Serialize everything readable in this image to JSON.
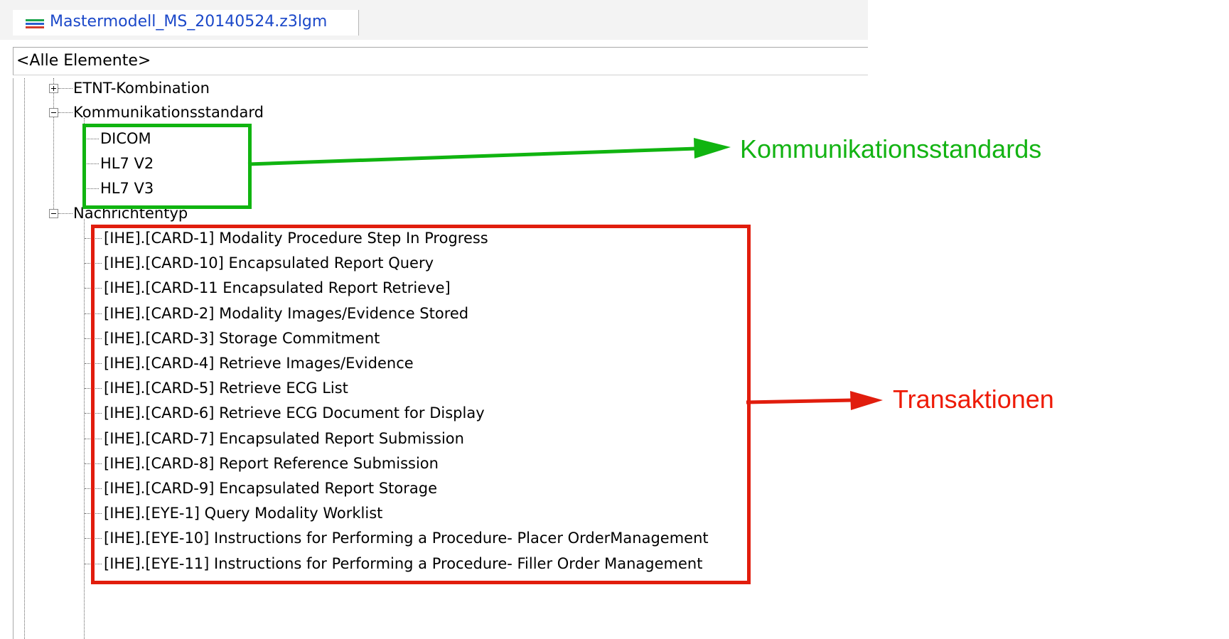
{
  "tab": {
    "title": "Mastermodell_MS_20140524.z3lgm",
    "icon": "list-icon"
  },
  "filter": {
    "value": "<Alle Elemente>"
  },
  "tree": {
    "groups": [
      {
        "label": "ETNT-Kombination",
        "state": "collapsed"
      },
      {
        "label": "Kommunikationsstandard",
        "state": "expanded",
        "children": [
          "DICOM",
          "HL7 V2",
          "HL7 V3"
        ]
      },
      {
        "label": "Nachrichtentyp",
        "state": "expanded",
        "children": [
          "[IHE].[CARD-1] Modality Procedure Step In Progress",
          "[IHE].[CARD-10] Encapsulated Report Query",
          "[IHE].[CARD-11 Encapsulated Report Retrieve]",
          "[IHE].[CARD-2] Modality Images/Evidence Stored",
          "[IHE].[CARD-3] Storage Commitment",
          "[IHE].[CARD-4] Retrieve Images/Evidence",
          "[IHE].[CARD-5] Retrieve ECG List",
          "[IHE].[CARD-6] Retrieve ECG Document for Display",
          "[IHE].[CARD-7] Encapsulated Report Submission",
          "[IHE].[CARD-8] Report Reference Submission",
          "[IHE].[CARD-9] Encapsulated Report Storage",
          "[IHE].[EYE-1] Query Modality Worklist",
          "[IHE].[EYE-10]  Instructions for Performing a Procedure- Placer OrderManagement",
          "[IHE].[EYE-11]  Instructions for Performing a Procedure- Filler Order Management"
        ]
      }
    ]
  },
  "annotations": {
    "green_label": "Kommunikationsstandards",
    "red_label": "Transaktionen",
    "green_color": "#13b313",
    "red_color": "#ee1a06"
  }
}
